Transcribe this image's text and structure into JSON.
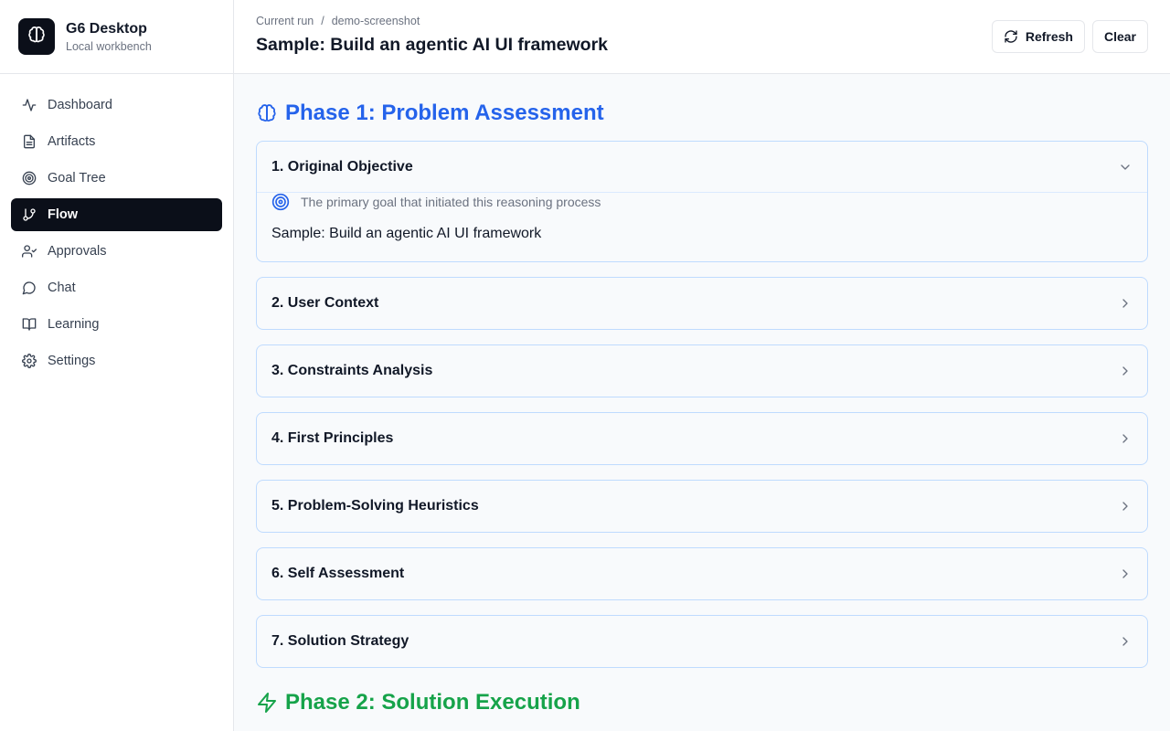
{
  "app": {
    "title": "G6 Desktop",
    "subtitle": "Local workbench"
  },
  "sidebar": {
    "items": [
      {
        "label": "Dashboard",
        "icon": "activity-icon"
      },
      {
        "label": "Artifacts",
        "icon": "file-text-icon"
      },
      {
        "label": "Goal Tree",
        "icon": "target-icon"
      },
      {
        "label": "Flow",
        "icon": "git-branch-icon",
        "active": true
      },
      {
        "label": "Approvals",
        "icon": "user-check-icon"
      },
      {
        "label": "Chat",
        "icon": "message-circle-icon"
      },
      {
        "label": "Learning",
        "icon": "book-open-icon"
      },
      {
        "label": "Settings",
        "icon": "gear-icon"
      }
    ]
  },
  "header": {
    "breadcrumb": [
      "Current run",
      "demo-screenshot"
    ],
    "breadcrumb_sep": "/",
    "title": "Sample: Build an agentic AI UI framework",
    "refresh_label": "Refresh",
    "clear_label": "Clear"
  },
  "main": {
    "phase1": {
      "title": "Phase 1: Problem Assessment",
      "color": "#2563eb",
      "icon": "brain-icon"
    },
    "sections": [
      {
        "title": "1. Original Objective",
        "expanded": true,
        "description": "The primary goal that initiated this reasoning process",
        "content": "Sample: Build an agentic AI UI framework"
      },
      {
        "title": "2. User Context",
        "expanded": false
      },
      {
        "title": "3. Constraints Analysis",
        "expanded": false
      },
      {
        "title": "4. First Principles",
        "expanded": false
      },
      {
        "title": "5. Problem-Solving Heuristics",
        "expanded": false
      },
      {
        "title": "6. Self Assessment",
        "expanded": false
      },
      {
        "title": "7. Solution Strategy",
        "expanded": false
      }
    ],
    "phase2": {
      "title": "Phase 2: Solution Execution",
      "color": "#16a34a",
      "icon": "zap-icon"
    }
  }
}
